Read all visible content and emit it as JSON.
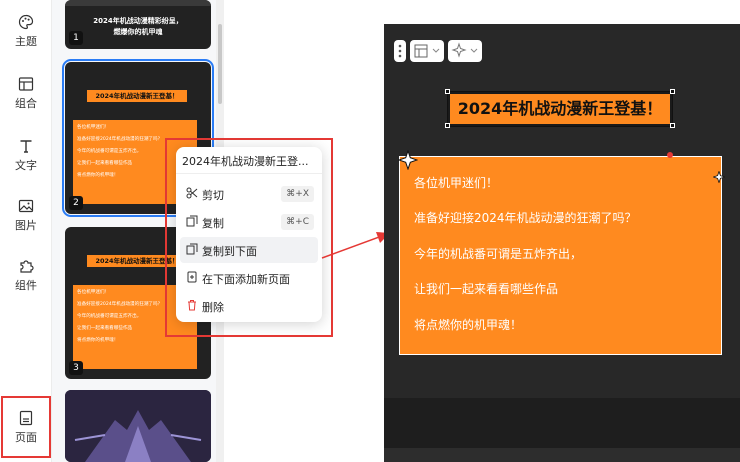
{
  "rail": {
    "items": [
      {
        "label": "主题",
        "icon": "palette-icon"
      },
      {
        "label": "组合",
        "icon": "layout-icon"
      },
      {
        "label": "文字",
        "icon": "text-icon"
      },
      {
        "label": "图片",
        "icon": "image-icon"
      },
      {
        "label": "组件",
        "icon": "puzzle-icon"
      },
      {
        "label": "页面",
        "icon": "page-icon"
      }
    ]
  },
  "thumbnails": [
    {
      "number": "1",
      "title_line1": "2024年机战动漫精彩纷呈，",
      "title_line2": "燃爆你的机甲魂"
    },
    {
      "number": "2",
      "banner": "2024年机战动漫新王登基！",
      "lines": [
        "各位机甲迷们！",
        "准备好迎接2024年机战动漫的狂潮了吗？",
        "今年的机战番可谓是五炸齐出，",
        "让我们一起来看看哪些作品",
        "将点燃你的机甲魂！"
      ]
    },
    {
      "number": "3",
      "banner": "2024年机战动漫新王登基！",
      "lines": [
        "各位机甲迷们！",
        "准备好迎接2024年机战动漫的狂潮了吗？",
        "今年的机战番可谓是五炸齐出，",
        "让我们一起来看看哪些作品",
        "将点燃你的机甲魂！"
      ]
    }
  ],
  "context_menu": {
    "title": "2024年机战动漫新王登...",
    "items": [
      {
        "label": "剪切",
        "shortcut": "⌘+X",
        "icon": "scissors-icon"
      },
      {
        "label": "复制",
        "shortcut": "⌘+C",
        "icon": "copy-icon"
      },
      {
        "label": "复制到下面",
        "shortcut": "",
        "icon": "duplicate-icon"
      },
      {
        "label": "在下面添加新页面",
        "shortcut": "",
        "icon": "add-page-icon"
      },
      {
        "label": "删除",
        "shortcut": "",
        "icon": "trash-icon"
      }
    ]
  },
  "canvas": {
    "headline": "2024年机战动漫新王登基！",
    "card_lines": [
      "各位机甲迷们！",
      "准备好迎接2024年机战动漫的狂潮了吗？",
      "今年的机战番可谓是五炸齐出，",
      "让我们一起来看看哪些作品",
      "将点燃你的机甲魂！"
    ]
  },
  "colors": {
    "accent": "#ff8a1f",
    "highlight": "#e53935",
    "selection": "#2a7cf5"
  }
}
